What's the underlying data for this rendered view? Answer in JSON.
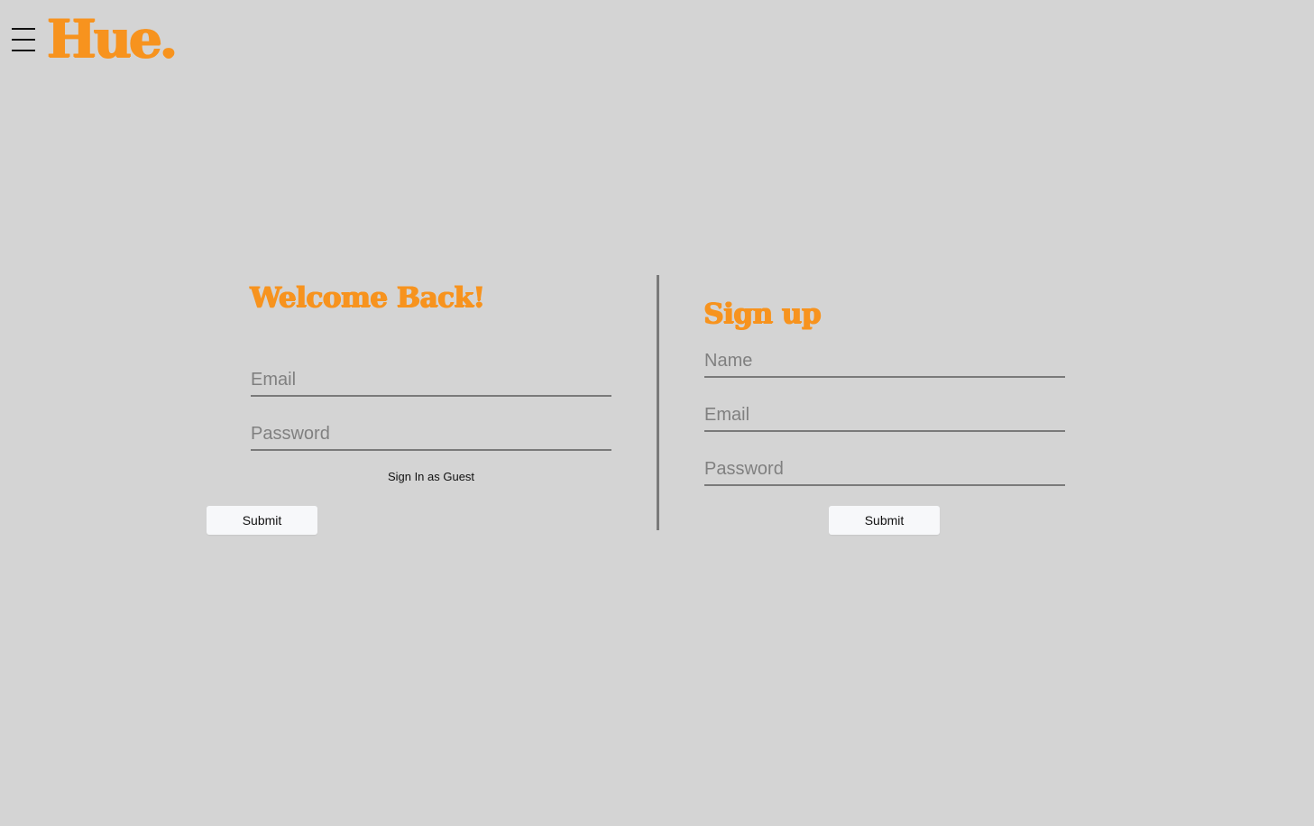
{
  "header": {
    "logo_text": "Hue.",
    "menu_icon": "hamburger-menu-icon"
  },
  "login": {
    "title": "Welcome Back!",
    "email_placeholder": "Email",
    "password_placeholder": "Password",
    "guest_link": "Sign In as Guest",
    "submit_label": "Submit"
  },
  "signup": {
    "title": "Sign up",
    "name_placeholder": "Name",
    "email_placeholder": "Email",
    "password_placeholder": "Password",
    "submit_label": "Submit"
  },
  "colors": {
    "accent": "#f7931e",
    "background": "#d4d4d4",
    "divider": "#7a7a7a",
    "button": "#f7f8fa"
  }
}
